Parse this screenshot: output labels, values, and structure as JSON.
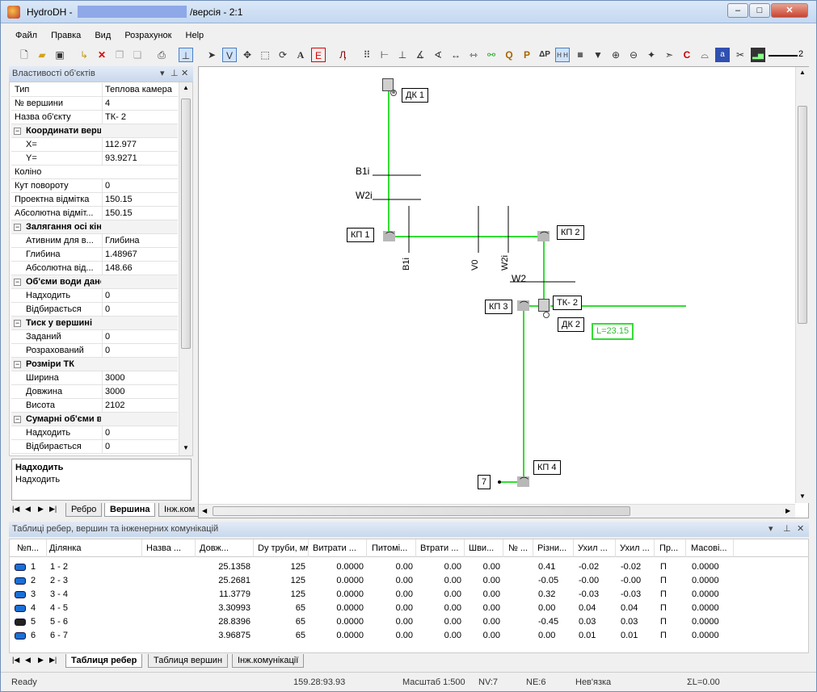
{
  "window": {
    "title_prefix": "HydroDH -",
    "title_suffix": "/версія - 2:1",
    "min": "–",
    "max": "□",
    "close": "✕"
  },
  "menu": [
    "Файл",
    "Правка",
    "Вид",
    "Розрахунок",
    "Help"
  ],
  "toolbar": {
    "line_width_value": "2"
  },
  "properties": {
    "title": "Властивості об'єктів",
    "rows": [
      {
        "k": "Тип",
        "v": "Теплова камера"
      },
      {
        "k": "№ вершини",
        "v": "4"
      },
      {
        "k": "Назва об'єкту",
        "v": "ТК- 2"
      },
      {
        "k": "Координати вершини",
        "v": ""
      },
      {
        "k": "X=",
        "v": "112.977"
      },
      {
        "k": "Y=",
        "v": "93.9271"
      },
      {
        "k": "Коліно",
        "v": ""
      },
      {
        "k": "Кут повороту",
        "v": "0"
      },
      {
        "k": "Проектна відмітка",
        "v": "150.15"
      },
      {
        "k": "Абсолютна відміт...",
        "v": "150.15"
      },
      {
        "k": "Залягання осі кінця труби",
        "v": ""
      },
      {
        "k": "Ативним для в...",
        "v": "Глибина"
      },
      {
        "k": "Глибина",
        "v": "1.48967"
      },
      {
        "k": "Абсолютна від...",
        "v": "148.66"
      },
      {
        "k": "Об'єми води даної вершини",
        "v": ""
      },
      {
        "k": "Надходить",
        "v": "0"
      },
      {
        "k": "Відбирається",
        "v": "0"
      },
      {
        "k": "Тиск у вершині",
        "v": ""
      },
      {
        "k": "Заданий",
        "v": "0"
      },
      {
        "k": "Розрахований",
        "v": "0"
      },
      {
        "k": "Розміри ТК",
        "v": ""
      },
      {
        "k": "Ширина",
        "v": "3000"
      },
      {
        "k": "Довжина",
        "v": "3000"
      },
      {
        "k": "Висота",
        "v": "2102"
      },
      {
        "k": "Сумарні об'єми води мережі",
        "v": ""
      },
      {
        "k": "Надходить",
        "v": "0"
      },
      {
        "k": "Відбирається",
        "v": "0"
      }
    ],
    "desc_title": "Надходить",
    "desc_text": "Надходить",
    "tabs": [
      "Ребро",
      "Вершина",
      "Інж.ком"
    ]
  },
  "canvas": {
    "labels": {
      "dk1": "ДК 1",
      "kp1": "КП 1",
      "kp2": "КП 2",
      "kp3": "КП 3",
      "tk2": "ТК- 2",
      "dk2": "ДК 2",
      "kp4": "КП 4",
      "n7": "7",
      "length": "L=23.15",
      "b1i_h": "B1i",
      "w2i_h": "W2i",
      "w2_h": "W2",
      "b1i_v": "B1i",
      "v0_v": "V0",
      "w2i_v": "W2i"
    },
    "colors": {
      "pipe": "#33dd33",
      "node": "#b8b8b8"
    }
  },
  "table": {
    "title": "Таблиці ребер, вершин та інженерних комунікацій",
    "headers": [
      "№п...",
      "Ділянка",
      "Назва ...",
      "Довж...",
      "Dy труби, мм",
      "Витрати ...",
      "Питомі...",
      "Втрати ...",
      "Шви...",
      "№ ...",
      "Різни...",
      "Ухил ...",
      "Ухил ...",
      "Пр...",
      "Масові..."
    ],
    "rows": [
      [
        "1",
        "1 - 2",
        "",
        "25.1358",
        "125",
        "0.0000",
        "0.00",
        "0.00",
        "0.00",
        "",
        "0.41",
        "-0.02",
        "-0.02",
        "П",
        "0.0000"
      ],
      [
        "2",
        "2 - 3",
        "",
        "25.2681",
        "125",
        "0.0000",
        "0.00",
        "0.00",
        "0.00",
        "",
        "-0.05",
        "-0.00",
        "-0.00",
        "П",
        "0.0000"
      ],
      [
        "3",
        "3 - 4",
        "",
        "11.3779",
        "125",
        "0.0000",
        "0.00",
        "0.00",
        "0.00",
        "",
        "0.32",
        "-0.03",
        "-0.03",
        "П",
        "0.0000"
      ],
      [
        "4",
        "4 - 5",
        "",
        "3.30993",
        "65",
        "0.0000",
        "0.00",
        "0.00",
        "0.00",
        "",
        "0.00",
        "0.04",
        "0.04",
        "П",
        "0.0000"
      ],
      [
        "5",
        "5 - 6",
        "",
        "28.8396",
        "65",
        "0.0000",
        "0.00",
        "0.00",
        "0.00",
        "",
        "-0.45",
        "0.03",
        "0.03",
        "П",
        "0.0000"
      ],
      [
        "6",
        "6 - 7",
        "",
        "3.96875",
        "65",
        "0.0000",
        "0.00",
        "0.00",
        "0.00",
        "",
        "0.00",
        "0.01",
        "0.01",
        "П",
        "0.0000"
      ]
    ],
    "tabs": [
      "Таблиця ребер",
      "Таблиця вершин",
      "Інж.комунікації"
    ]
  },
  "status": {
    "ready": "Ready",
    "coords": "159.28:93.93",
    "scale": "Масштаб 1:500",
    "nv": "NV:7",
    "ne": "NE:6",
    "bind": "Нев'язка",
    "sum": "ΣL=0.00"
  }
}
